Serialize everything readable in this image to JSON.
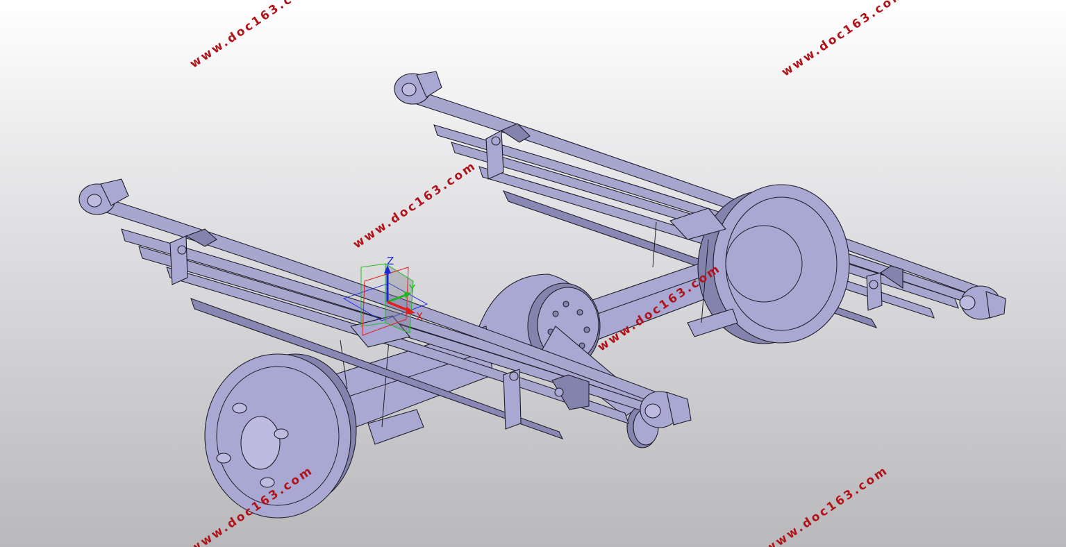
{
  "viewport": {
    "background_top": "#ffffff",
    "background_bottom": "#b9b9bc",
    "model_color": "#a7a6cf",
    "edge_color": "#1f1f2c"
  },
  "triad": {
    "x_label": "X",
    "y_label": "Y",
    "z_label": "Z",
    "x_color": "#e0201c",
    "y_color": "#21b321",
    "z_color": "#1a27d6"
  },
  "watermarks": [
    {
      "text": "www.doc163.com"
    },
    {
      "text": "www.doc163.com"
    },
    {
      "text": "www.doc163.com"
    },
    {
      "text": "www.doc163.com"
    },
    {
      "text": "www.doc163.com"
    },
    {
      "text": "www.doc163.com"
    }
  ],
  "watermark_color": "#b0141b"
}
